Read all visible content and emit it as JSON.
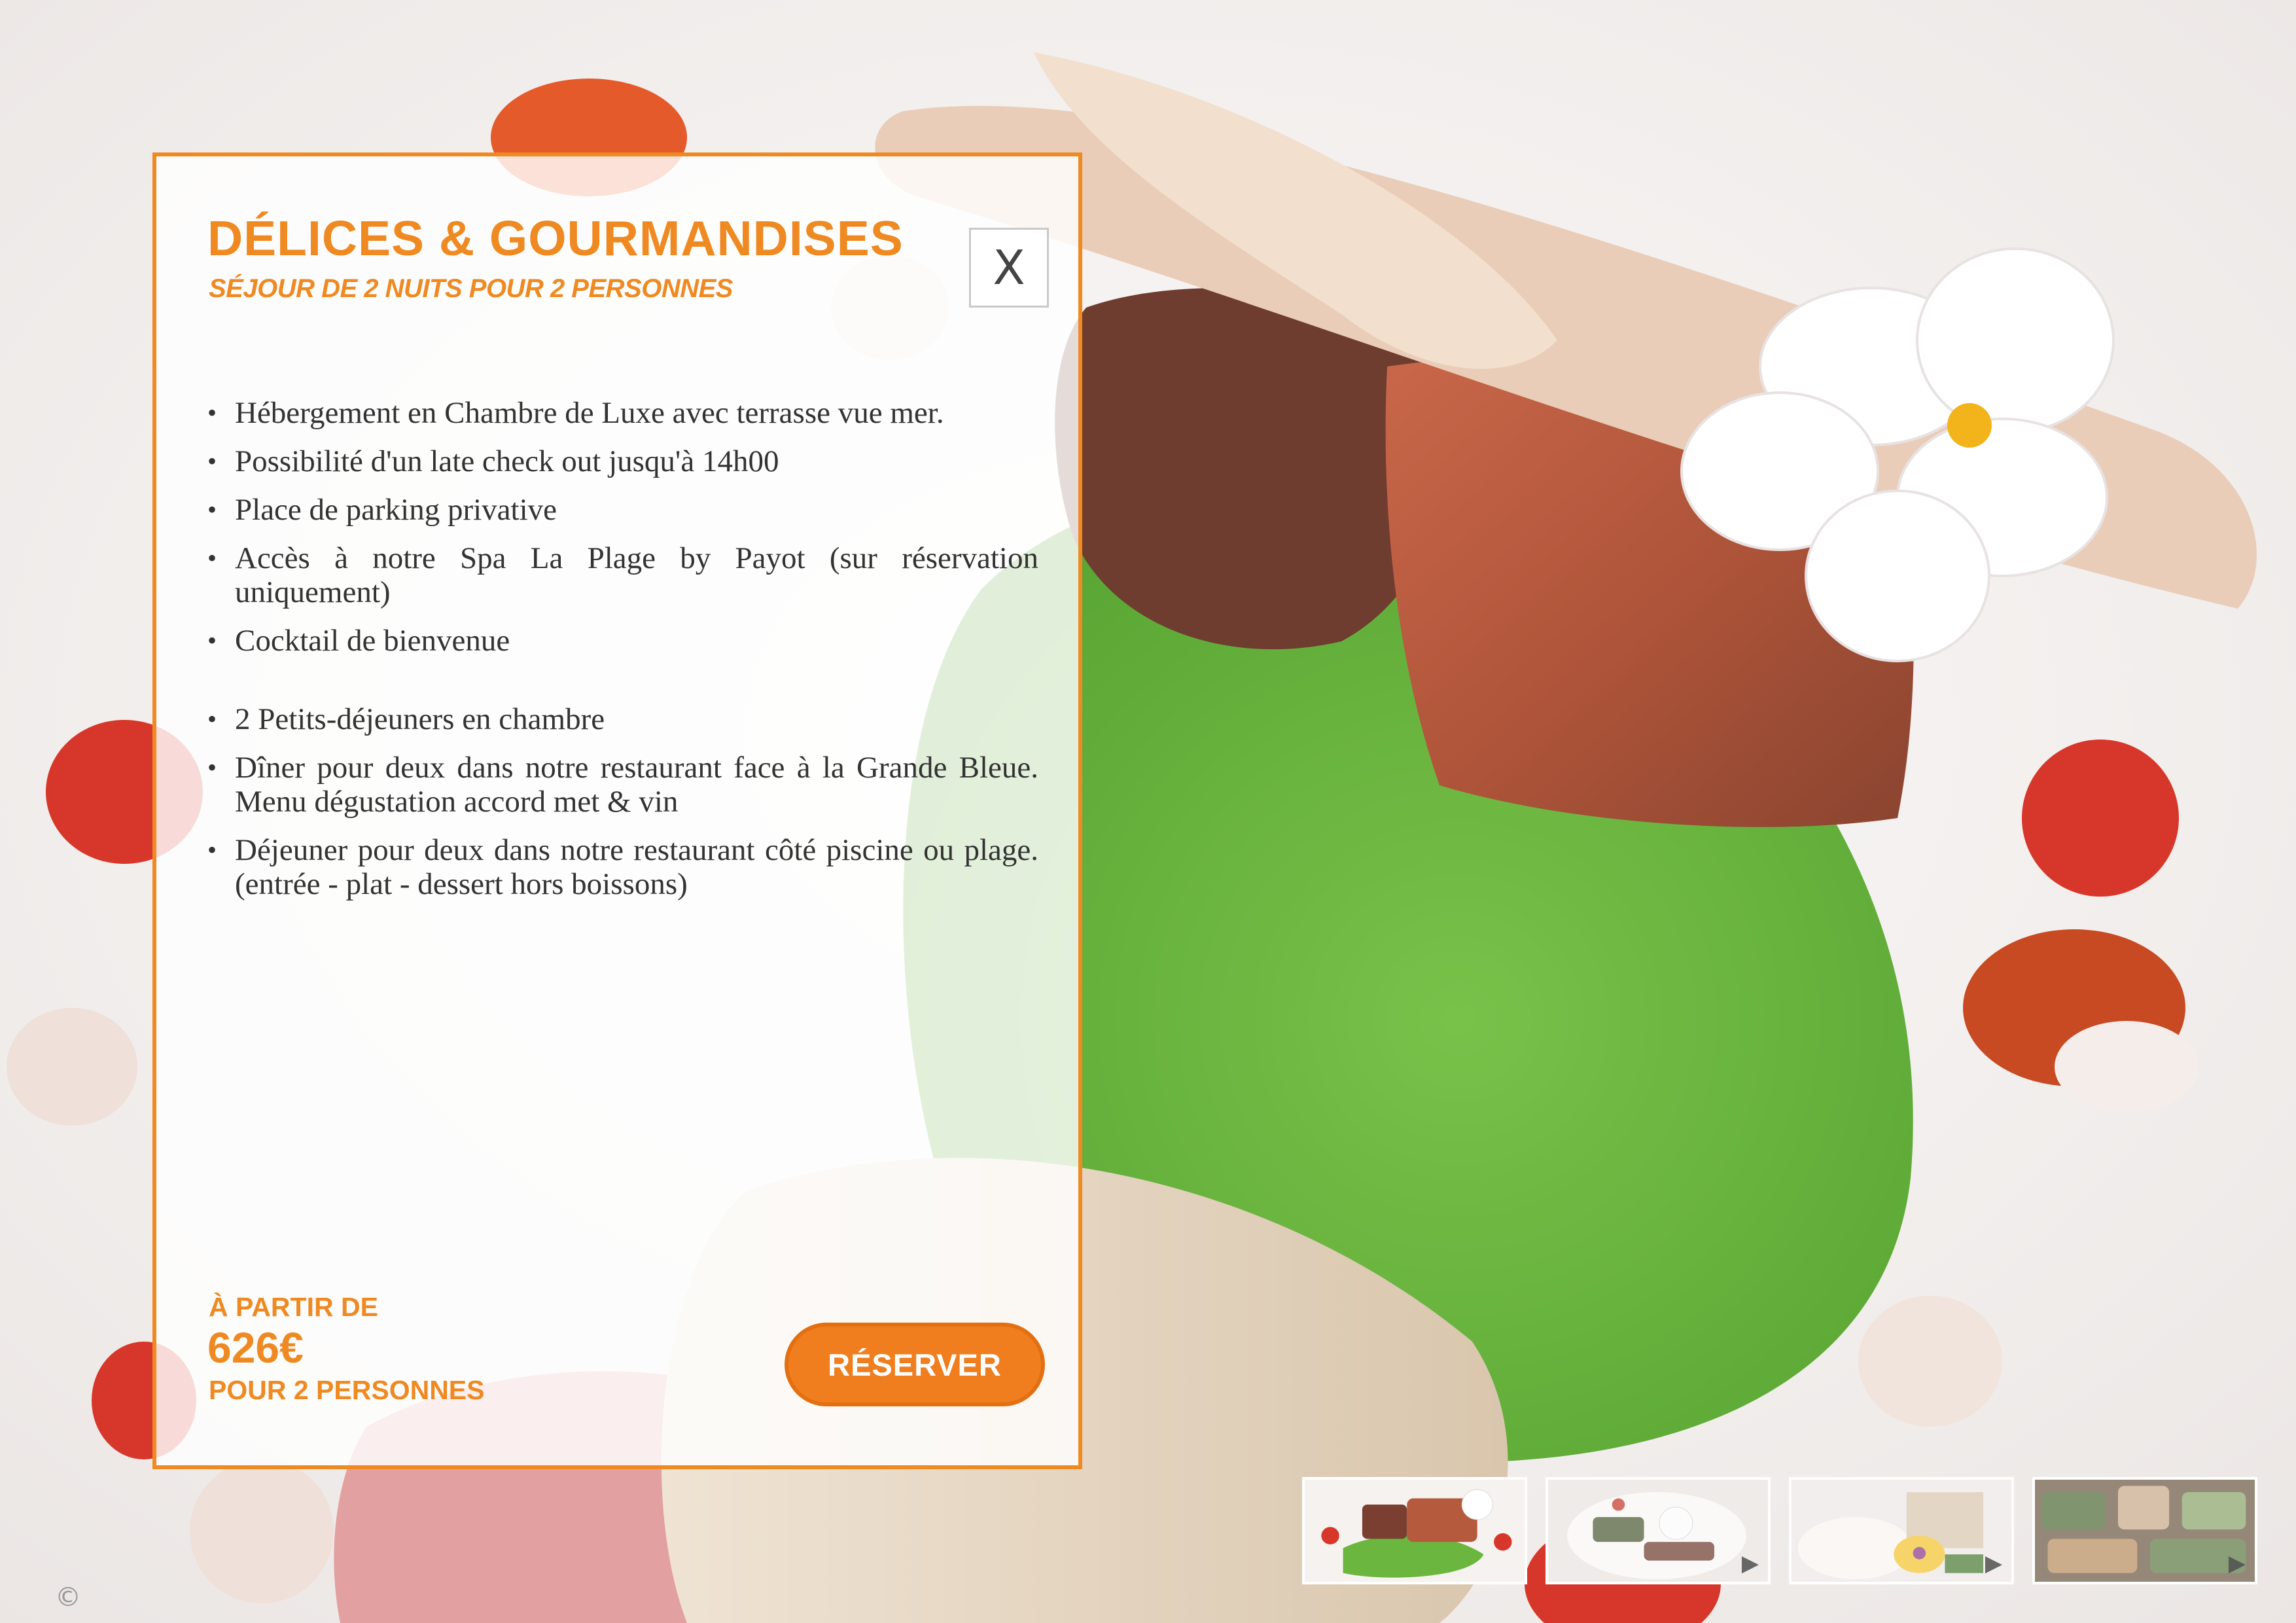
{
  "offer": {
    "title": "DÉLICES & GOURMANDISES",
    "subtitle": "SÉJOUR DE 2 NUITS POUR 2 PERSONNES",
    "close_label": "X",
    "features": [
      "Hébergement en Chambre de Luxe avec terrasse vue mer.",
      "Possibilité d'un late check out  jusqu'à 14h00",
      "Place de parking privative",
      "Accès à notre Spa La Plage by Payot (sur réservation uniquement)",
      "Cocktail de bienvenue",
      "2 Petits-déjeuners en chambre",
      "Dîner pour deux dans notre restaurant face à la Grande Bleue. Menu dégustation accord met & vin",
      "Déjeuner pour deux dans notre restaurant côté piscine ou plage. (entrée - plat - dessert hors boissons)"
    ],
    "price": {
      "from_label": "À PARTIR DE",
      "amount": "626€",
      "per_label": "POUR 2 PERSONNES"
    },
    "book_label": "RÉSERVER"
  },
  "gallery": {
    "play_glyph": "▶",
    "thumbnails": [
      {
        "name": "plated-meat-green-sauce",
        "active": true
      },
      {
        "name": "plated-dish-overhead",
        "active": false
      },
      {
        "name": "white-flower-dessert",
        "active": false
      },
      {
        "name": "table-spread",
        "active": false
      }
    ]
  },
  "copyright_glyph": "©",
  "colors": {
    "accent": "#ef8a22",
    "button": "#f07e1e",
    "text": "#333333",
    "sauce_green": "#69b43f"
  }
}
